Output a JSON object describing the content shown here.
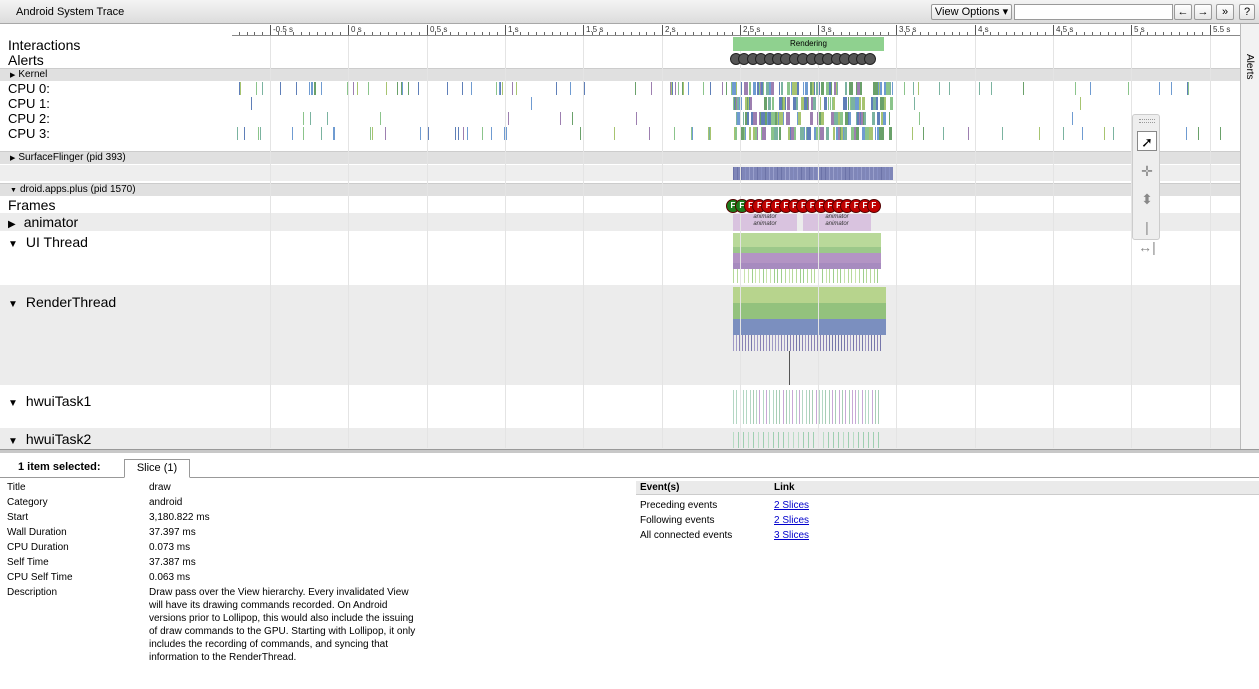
{
  "app_title": "Android System Trace",
  "toolbar": {
    "view_options": "View Options ▾",
    "search_value": "",
    "prev": "←",
    "next": "→",
    "more": "»",
    "help": "?"
  },
  "ruler_labels": [
    "-0.5 s",
    "0 s",
    "0.5 s",
    "1 s",
    "1.5 s",
    "2 s",
    "2.5 s",
    "3 s",
    "3.5 s",
    "4 s",
    "4.5 s",
    "5 s",
    "5.5 s"
  ],
  "tracks": {
    "interactions": "Interactions",
    "interaction_bar": "Rendering",
    "alerts": "Alerts",
    "kernel": "Kernel",
    "cpu": [
      "CPU 0:",
      "CPU 1:",
      "CPU 2:",
      "CPU 3:"
    ],
    "surfaceflinger": "SurfaceFlinger (pid 393)",
    "process": "droid.apps.plus (pid 1570)",
    "frames": "Frames",
    "animator": "animator",
    "ui_thread": "UI Thread",
    "render_thread": "RenderThread",
    "hwui1": "hwuiTask1",
    "hwui2": "hwuiTask2",
    "animator_slice": "animator"
  },
  "alerts_side": "Alerts",
  "selection": {
    "label": "1 item selected:",
    "tab": "Slice (1)"
  },
  "details": [
    {
      "k": "Title",
      "v": "draw"
    },
    {
      "k": "Category",
      "v": "android"
    },
    {
      "k": "Start",
      "v": "3,180.822 ms"
    },
    {
      "k": "Wall Duration",
      "v": "37.397 ms"
    },
    {
      "k": "CPU Duration",
      "v": "0.073 ms"
    },
    {
      "k": "Self Time",
      "v": "37.387 ms"
    },
    {
      "k": "CPU Self Time",
      "v": "0.063 ms"
    },
    {
      "k": "Description",
      "v": "Draw pass over the View hierarchy. Every invalidated View will have its drawing commands recorded. On Android versions prior to Lollipop, this would also include the issuing of draw commands to the GPU. Starting with Lollipop, it only includes the recording of commands, and syncing that information to the RenderThread."
    }
  ],
  "events": {
    "head_event": "Event(s)",
    "head_link": "Link",
    "rows": [
      {
        "name": "Preceding events",
        "link": "2 Slices"
      },
      {
        "name": "Following events",
        "link": "2 Slices"
      },
      {
        "name": "All connected events",
        "link": "3 Slices"
      }
    ]
  },
  "colors": {
    "rendering": "#8fd18f",
    "frame_red": "#c00000",
    "frame_green": "#1c7a1c",
    "alert_gray": "#555555"
  }
}
